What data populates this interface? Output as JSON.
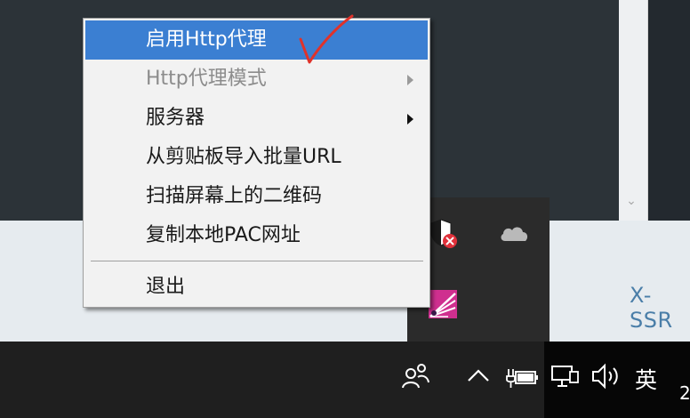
{
  "context_menu": {
    "items": [
      {
        "label": "启用Http代理",
        "state": "highlighted",
        "has_submenu": false
      },
      {
        "label": "Http代理模式",
        "state": "disabled",
        "has_submenu": true
      },
      {
        "label": "服务器",
        "state": "normal",
        "has_submenu": true
      },
      {
        "label": "从剪贴板导入批量URL",
        "state": "normal",
        "has_submenu": false
      },
      {
        "label": "扫描屏幕上的二维码",
        "state": "normal",
        "has_submenu": false
      },
      {
        "label": "复制本地PAC网址",
        "state": "normal",
        "has_submenu": false
      },
      {
        "label": "退出",
        "state": "normal",
        "has_submenu": false
      }
    ],
    "highlight_color": "#3b7fd2",
    "annotation_color": "#e0322a"
  },
  "background": {
    "partial_text": "X-SSR"
  },
  "tray_overflow": {
    "icons": [
      "shield-warning-icon",
      "cloud-icon",
      "app-icon"
    ]
  },
  "taskbar": {
    "icons": [
      "people-icon",
      "chevron-up-icon",
      "power-icon",
      "network-icon",
      "volume-icon"
    ],
    "ime_indicator": "英",
    "clock_fragment": "2"
  }
}
